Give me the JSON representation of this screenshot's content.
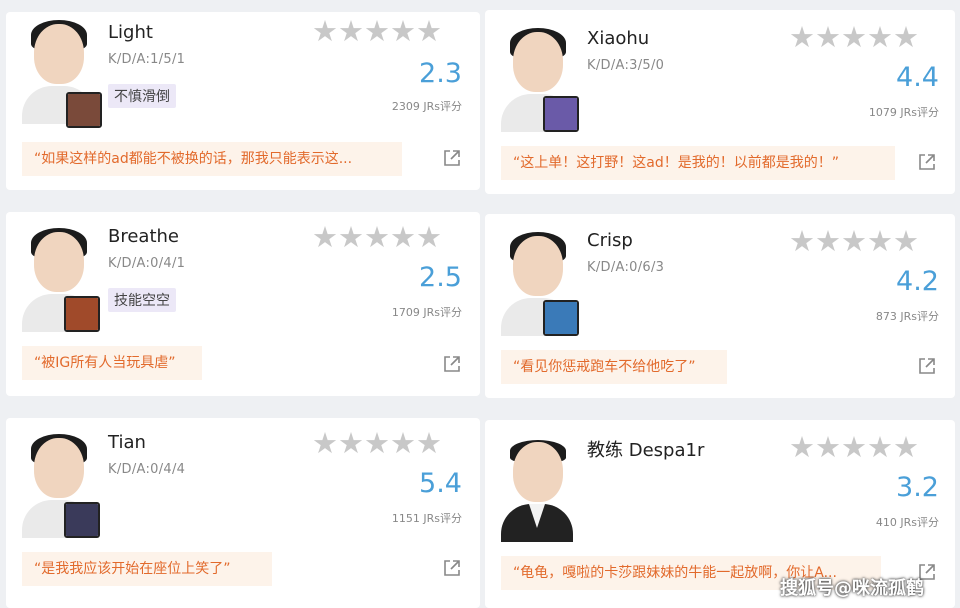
{
  "stars_glyph": "★★★★★",
  "players": [
    {
      "name": "Light",
      "kda": "K/D/A:1/5/1",
      "tag": "不慎滑倒",
      "score": "2.3",
      "ratings": "2309 JRs评分",
      "quote": "“如果这样的ad都能不被换的话，那我只能表示这...",
      "champ_color": "#7a4a3a"
    },
    {
      "name": "Xiaohu",
      "kda": "K/D/A:3/5/0",
      "tag": "",
      "score": "4.4",
      "ratings": "1079 JRs评分",
      "quote": "“这上单！这打野！这ad！是我的！以前都是我的！”",
      "champ_color": "#6a5aa8"
    },
    {
      "name": "Breathe",
      "kda": "K/D/A:0/4/1",
      "tag": "技能空空",
      "score": "2.5",
      "ratings": "1709 JRs评分",
      "quote": "“被IG所有人当玩具虐”",
      "champ_color": "#a04a2a"
    },
    {
      "name": "Crisp",
      "kda": "K/D/A:0/6/3",
      "tag": "",
      "score": "4.2",
      "ratings": "873 JRs评分",
      "quote": "“看见你惩戒跑车不给他吃了”",
      "champ_color": "#3a7ab8"
    },
    {
      "name": "Tian",
      "kda": "K/D/A:0/4/4",
      "tag": "",
      "score": "5.4",
      "ratings": "1151 JRs评分",
      "quote": "“是我我应该开始在座位上笑了”",
      "champ_color": "#3a3a5a"
    },
    {
      "name": "教练 Despa1r",
      "kda": "",
      "tag": "",
      "score": "3.2",
      "ratings": "410 JRs评分",
      "quote": "“龟龟，嘎啦的卡莎跟妹妹的牛能一起放啊，你让A...",
      "champ_color": ""
    }
  ],
  "watermark": "搜狐号@咪流孤鹤"
}
